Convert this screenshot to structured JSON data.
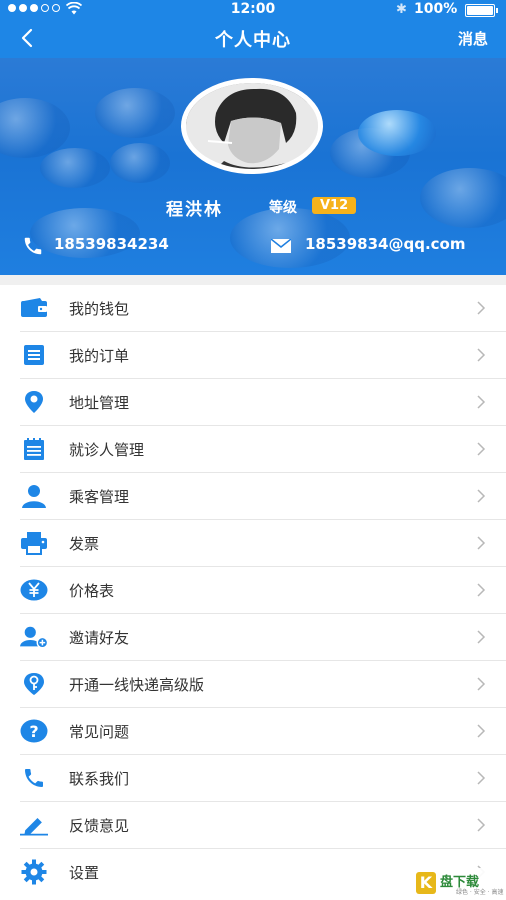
{
  "status_bar": {
    "time": "12:00",
    "battery": "100%"
  },
  "nav": {
    "title": "个人中心",
    "right_action": "消息"
  },
  "profile": {
    "name": "程洪林",
    "level_label": "等级",
    "level_value": "V12",
    "phone": "18539834234",
    "email": "18539834@qq.com"
  },
  "menu": {
    "items": [
      {
        "label": "我的钱包",
        "icon": "wallet-icon"
      },
      {
        "label": "我的订单",
        "icon": "order-list-icon"
      },
      {
        "label": "地址管理",
        "icon": "location-pin-icon"
      },
      {
        "label": "就诊人管理",
        "icon": "notepad-icon"
      },
      {
        "label": "乘客管理",
        "icon": "person-icon"
      },
      {
        "label": "发票",
        "icon": "printer-icon"
      },
      {
        "label": "价格表",
        "icon": "yen-icon"
      },
      {
        "label": "邀请好友",
        "icon": "add-friend-icon"
      },
      {
        "label": "开通一线快递高级版",
        "icon": "key-pin-icon"
      },
      {
        "label": "常见问题",
        "icon": "question-icon"
      },
      {
        "label": "联系我们",
        "icon": "phone-icon"
      },
      {
        "label": "反馈意见",
        "icon": "pencil-icon"
      },
      {
        "label": "设置",
        "icon": "gear-icon"
      }
    ]
  },
  "watermark": {
    "main": "盘下载",
    "sub": "绿色 · 安全 · 高速"
  },
  "colors": {
    "primary": "#1e86e6",
    "badge": "#f6b21b",
    "text": "#333333"
  }
}
